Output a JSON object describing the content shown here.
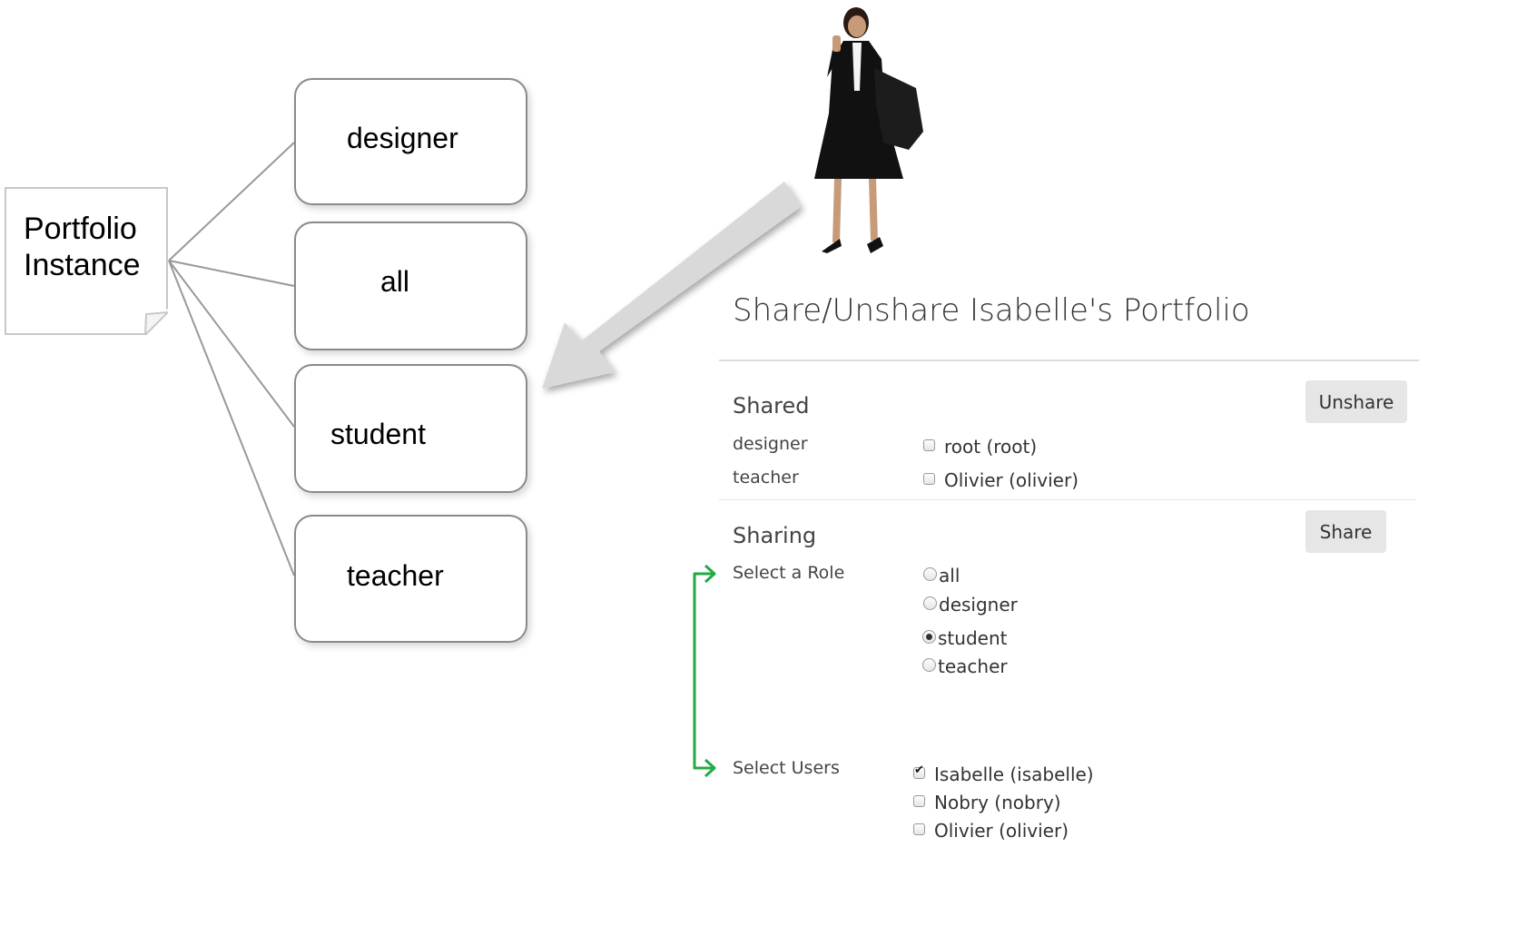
{
  "diagram": {
    "root_node": "Portfolio\nInstance",
    "roles": [
      {
        "label": "designer"
      },
      {
        "label": "all"
      },
      {
        "label": "student"
      },
      {
        "label": "teacher"
      }
    ],
    "arrow_color": "#d9d9d9",
    "connector_color": "#999999"
  },
  "share_panel": {
    "title": "Share/Unshare Isabelle's Portfolio",
    "shared": {
      "heading": "Shared",
      "unshare_label": "Unshare",
      "rows": [
        {
          "role": "designer",
          "user": "root (root)",
          "checked": false
        },
        {
          "role": "teacher",
          "user": "Olivier (olivier)",
          "checked": false
        }
      ]
    },
    "sharing": {
      "heading": "Sharing",
      "share_label": "Share",
      "select_role_label": "Select a Role",
      "roles": [
        {
          "label": "all",
          "selected": false
        },
        {
          "label": "designer",
          "selected": false
        },
        {
          "label": "student",
          "selected": true
        },
        {
          "label": "teacher",
          "selected": false
        }
      ],
      "select_users_label": "Select Users",
      "users": [
        {
          "label": "Isabelle (isabelle)",
          "checked": true
        },
        {
          "label": "Nobry (nobry)",
          "checked": false
        },
        {
          "label": "Olivier (olivier)",
          "checked": false
        }
      ]
    },
    "bracket_color": "#22aa44"
  }
}
